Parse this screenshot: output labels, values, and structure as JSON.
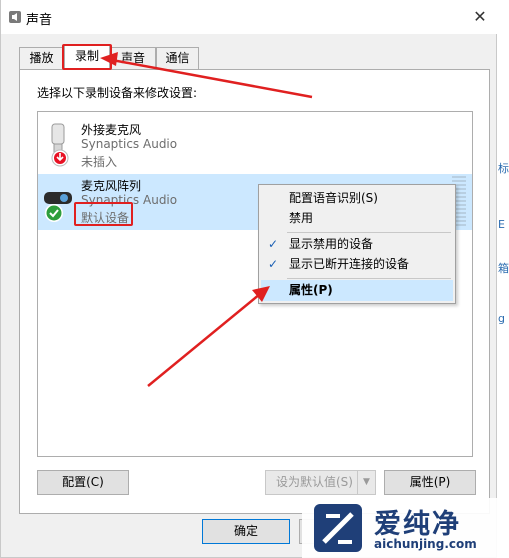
{
  "window": {
    "title": "声音",
    "close_glyph": "✕"
  },
  "tabs": [
    {
      "label": "播放"
    },
    {
      "label": "录制",
      "active": true
    },
    {
      "label": "声音"
    },
    {
      "label": "通信"
    }
  ],
  "panel": {
    "instruction": "选择以下录制设备来修改设置:",
    "devices": [
      {
        "name": "外接麦克风",
        "driver": "Synaptics Audio",
        "status": "未插入",
        "icon": "microphone-icon",
        "badge": "unplugged-badge-icon"
      },
      {
        "name": "麦克风阵列",
        "driver": "Synaptics Audio",
        "status": "默认设备",
        "icon": "webcam-mic-icon",
        "badge": "default-check-badge-icon",
        "selected": true
      }
    ]
  },
  "context_menu": {
    "items": [
      {
        "label": "配置语音识别(S)",
        "checked": false
      },
      {
        "label": "禁用",
        "checked": false
      },
      {
        "label": "显示禁用的设备",
        "checked": true
      },
      {
        "label": "显示已断开连接的设备",
        "checked": true
      },
      {
        "label": "属性(P)",
        "checked": false,
        "highlighted": true
      }
    ],
    "check_glyph": "✓"
  },
  "buttons": {
    "configure": "配置(C)",
    "set_default": "设为默认值(S)",
    "set_default_arrow": "▼",
    "properties": "属性(P)",
    "ok": "确定"
  },
  "background_chars": [
    "标",
    "E",
    "箱",
    "g"
  ],
  "watermark": {
    "title": "爱纯净",
    "url": "aichunjing.com"
  },
  "colors": {
    "annotation_red": "#e02020",
    "selection_blue": "#cce8ff",
    "watermark_blue": "#1f3f78"
  }
}
